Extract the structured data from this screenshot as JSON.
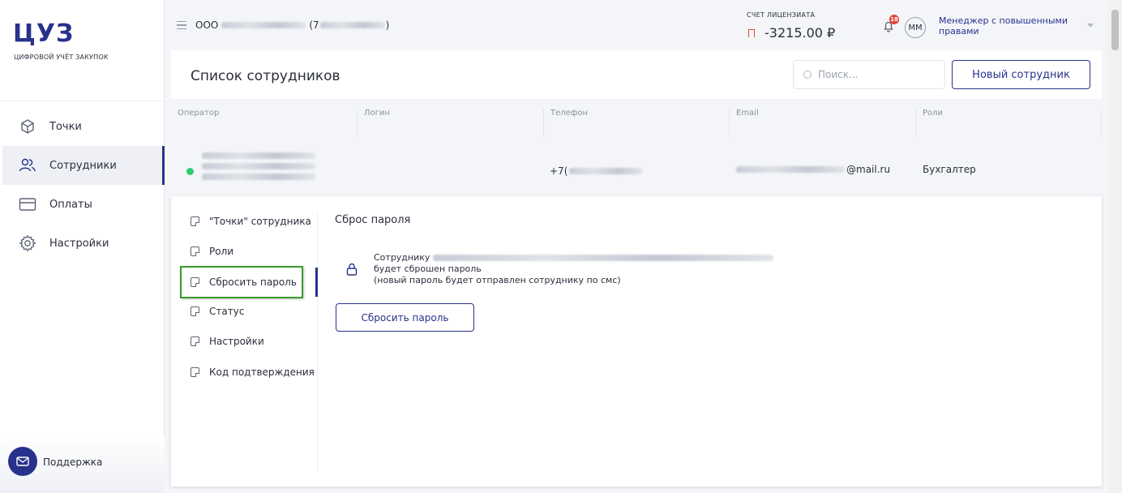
{
  "brand": {
    "logo": "ЦУЗ",
    "subtitle": "ЦИФРОВОЙ УЧЁТ ЗАКУПОК"
  },
  "sidebar": {
    "items": [
      {
        "label": "Точки",
        "icon": "cube-icon",
        "active": false
      },
      {
        "label": "Сотрудники",
        "icon": "users-icon",
        "active": true
      },
      {
        "label": "Оплаты",
        "icon": "card-icon",
        "active": false
      },
      {
        "label": "Настройки",
        "icon": "gear-icon",
        "active": false
      }
    ],
    "support_label": "Поддержка"
  },
  "header": {
    "org_prefix": "ООО",
    "org_open": "(7",
    "org_close": ")",
    "account_title": "СЧЕТ ЛИЦЕНЗИАТА",
    "account_value": "-3215.00 ₽",
    "notifications_count": "18",
    "avatar_initials": "ММ",
    "user_role": "Менеджер с повышенными правами"
  },
  "page": {
    "title": "Список сотрудников",
    "search_placeholder": "Поиск...",
    "new_employee_label": "Новый сотрудник"
  },
  "table": {
    "columns": [
      "Оператор",
      "Логин",
      "Телефон",
      "Email",
      "Роли"
    ],
    "rows": [
      {
        "status": "online",
        "operator": "",
        "login": "",
        "phone_prefix": "+7(",
        "email_suffix": "@mail.ru",
        "role": "Бухгалтер"
      }
    ]
  },
  "detail": {
    "menu": [
      {
        "label": "\"Точки\" сотрудника"
      },
      {
        "label": "Роли"
      },
      {
        "label": "Сбросить пароль",
        "active": true
      },
      {
        "label": "Статус"
      },
      {
        "label": "Настройки"
      },
      {
        "label": "Код подтверждения"
      }
    ],
    "section_title": "Сброс пароля",
    "text_line1": "Сотруднику",
    "text_line2": "будет сброшен пароль",
    "text_line3": "(новый пароль будет отправлен сотруднику по смс)",
    "reset_button": "Сбросить пароль"
  },
  "colors": {
    "brand": "#28328c",
    "danger": "#e2463c",
    "online": "#2ecc71",
    "highlight": "#3a9b2f"
  }
}
